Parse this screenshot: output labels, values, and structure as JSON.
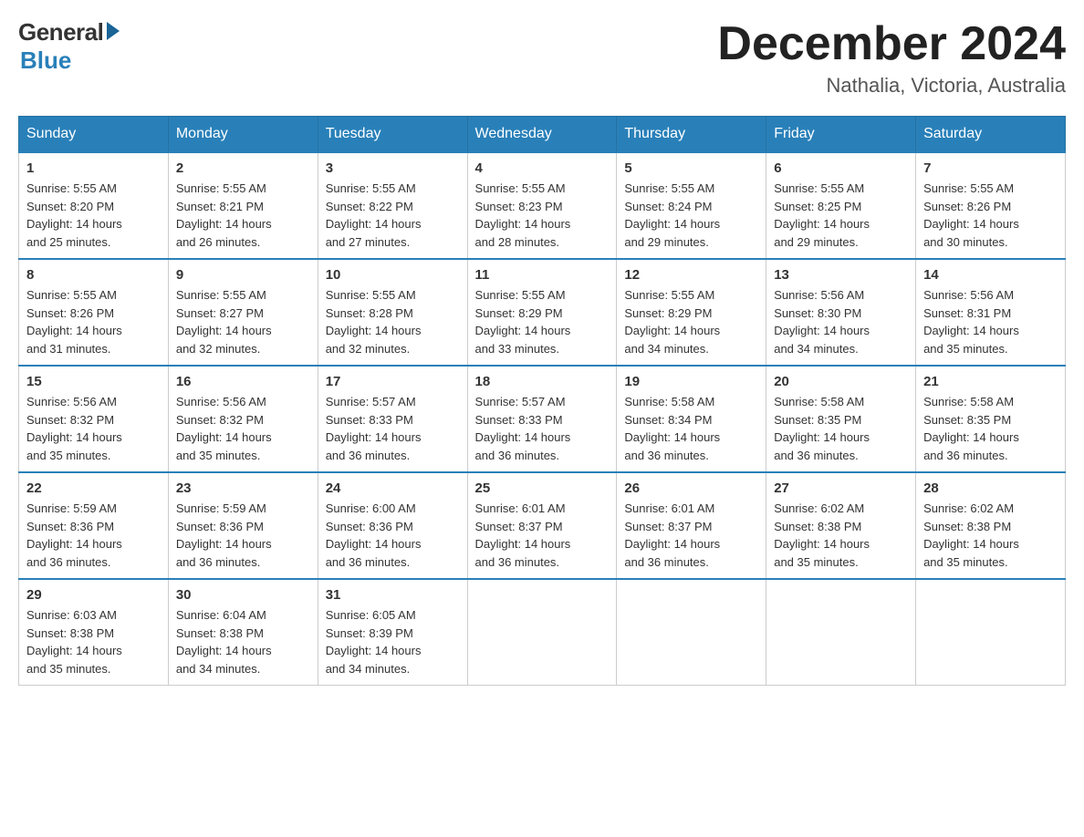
{
  "header": {
    "logo_general": "General",
    "logo_blue": "Blue",
    "month_title": "December 2024",
    "location": "Nathalia, Victoria, Australia"
  },
  "days_of_week": [
    "Sunday",
    "Monday",
    "Tuesday",
    "Wednesday",
    "Thursday",
    "Friday",
    "Saturday"
  ],
  "weeks": [
    [
      {
        "num": "1",
        "sunrise": "5:55 AM",
        "sunset": "8:20 PM",
        "daylight": "14 hours and 25 minutes."
      },
      {
        "num": "2",
        "sunrise": "5:55 AM",
        "sunset": "8:21 PM",
        "daylight": "14 hours and 26 minutes."
      },
      {
        "num": "3",
        "sunrise": "5:55 AM",
        "sunset": "8:22 PM",
        "daylight": "14 hours and 27 minutes."
      },
      {
        "num": "4",
        "sunrise": "5:55 AM",
        "sunset": "8:23 PM",
        "daylight": "14 hours and 28 minutes."
      },
      {
        "num": "5",
        "sunrise": "5:55 AM",
        "sunset": "8:24 PM",
        "daylight": "14 hours and 29 minutes."
      },
      {
        "num": "6",
        "sunrise": "5:55 AM",
        "sunset": "8:25 PM",
        "daylight": "14 hours and 29 minutes."
      },
      {
        "num": "7",
        "sunrise": "5:55 AM",
        "sunset": "8:26 PM",
        "daylight": "14 hours and 30 minutes."
      }
    ],
    [
      {
        "num": "8",
        "sunrise": "5:55 AM",
        "sunset": "8:26 PM",
        "daylight": "14 hours and 31 minutes."
      },
      {
        "num": "9",
        "sunrise": "5:55 AM",
        "sunset": "8:27 PM",
        "daylight": "14 hours and 32 minutes."
      },
      {
        "num": "10",
        "sunrise": "5:55 AM",
        "sunset": "8:28 PM",
        "daylight": "14 hours and 32 minutes."
      },
      {
        "num": "11",
        "sunrise": "5:55 AM",
        "sunset": "8:29 PM",
        "daylight": "14 hours and 33 minutes."
      },
      {
        "num": "12",
        "sunrise": "5:55 AM",
        "sunset": "8:29 PM",
        "daylight": "14 hours and 34 minutes."
      },
      {
        "num": "13",
        "sunrise": "5:56 AM",
        "sunset": "8:30 PM",
        "daylight": "14 hours and 34 minutes."
      },
      {
        "num": "14",
        "sunrise": "5:56 AM",
        "sunset": "8:31 PM",
        "daylight": "14 hours and 35 minutes."
      }
    ],
    [
      {
        "num": "15",
        "sunrise": "5:56 AM",
        "sunset": "8:32 PM",
        "daylight": "14 hours and 35 minutes."
      },
      {
        "num": "16",
        "sunrise": "5:56 AM",
        "sunset": "8:32 PM",
        "daylight": "14 hours and 35 minutes."
      },
      {
        "num": "17",
        "sunrise": "5:57 AM",
        "sunset": "8:33 PM",
        "daylight": "14 hours and 36 minutes."
      },
      {
        "num": "18",
        "sunrise": "5:57 AM",
        "sunset": "8:33 PM",
        "daylight": "14 hours and 36 minutes."
      },
      {
        "num": "19",
        "sunrise": "5:58 AM",
        "sunset": "8:34 PM",
        "daylight": "14 hours and 36 minutes."
      },
      {
        "num": "20",
        "sunrise": "5:58 AM",
        "sunset": "8:35 PM",
        "daylight": "14 hours and 36 minutes."
      },
      {
        "num": "21",
        "sunrise": "5:58 AM",
        "sunset": "8:35 PM",
        "daylight": "14 hours and 36 minutes."
      }
    ],
    [
      {
        "num": "22",
        "sunrise": "5:59 AM",
        "sunset": "8:36 PM",
        "daylight": "14 hours and 36 minutes."
      },
      {
        "num": "23",
        "sunrise": "5:59 AM",
        "sunset": "8:36 PM",
        "daylight": "14 hours and 36 minutes."
      },
      {
        "num": "24",
        "sunrise": "6:00 AM",
        "sunset": "8:36 PM",
        "daylight": "14 hours and 36 minutes."
      },
      {
        "num": "25",
        "sunrise": "6:01 AM",
        "sunset": "8:37 PM",
        "daylight": "14 hours and 36 minutes."
      },
      {
        "num": "26",
        "sunrise": "6:01 AM",
        "sunset": "8:37 PM",
        "daylight": "14 hours and 36 minutes."
      },
      {
        "num": "27",
        "sunrise": "6:02 AM",
        "sunset": "8:38 PM",
        "daylight": "14 hours and 35 minutes."
      },
      {
        "num": "28",
        "sunrise": "6:02 AM",
        "sunset": "8:38 PM",
        "daylight": "14 hours and 35 minutes."
      }
    ],
    [
      {
        "num": "29",
        "sunrise": "6:03 AM",
        "sunset": "8:38 PM",
        "daylight": "14 hours and 35 minutes."
      },
      {
        "num": "30",
        "sunrise": "6:04 AM",
        "sunset": "8:38 PM",
        "daylight": "14 hours and 34 minutes."
      },
      {
        "num": "31",
        "sunrise": "6:05 AM",
        "sunset": "8:39 PM",
        "daylight": "14 hours and 34 minutes."
      },
      null,
      null,
      null,
      null
    ]
  ],
  "labels": {
    "sunrise": "Sunrise:",
    "sunset": "Sunset:",
    "daylight": "Daylight:"
  }
}
